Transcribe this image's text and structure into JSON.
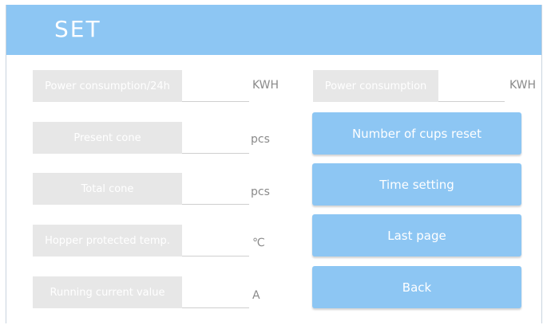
{
  "header": {
    "title": "SET"
  },
  "fields": [
    {
      "label": "Power consumption/24h",
      "value": "",
      "unit": "KWH"
    },
    {
      "label": "Present cone",
      "value": "",
      "unit": "pcs"
    },
    {
      "label": "Total cone",
      "value": "",
      "unit": "pcs"
    },
    {
      "label": "Hopper protected temp.",
      "value": "",
      "unit": "℃"
    },
    {
      "label": "Running current value",
      "value": "",
      "unit": "A"
    },
    {
      "label": "Power consumption",
      "value": "",
      "unit": "KWH"
    }
  ],
  "buttons": {
    "reset_cups": "Number of cups reset",
    "time_setting": "Time setting",
    "last_page": "Last page",
    "back": "Back"
  },
  "colors": {
    "accent": "#8dc6f3",
    "label_bg": "#e7e7e7"
  }
}
